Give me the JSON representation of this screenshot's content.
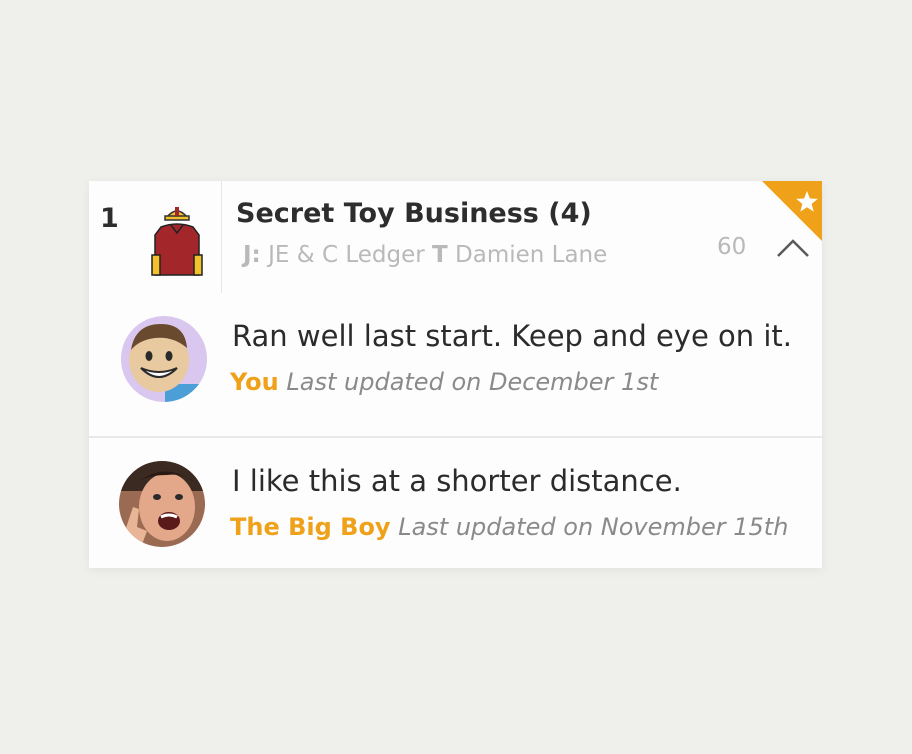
{
  "runner": {
    "number": "1",
    "name": "Secret Toy Business (4)",
    "jockey_prefix": "J:",
    "jockey": "JE & C Ledger",
    "trainer_prefix": "T",
    "trainer": "Damien Lane",
    "rating": "60",
    "collapse_icon": "chevron-up-icon",
    "favourite_icon": "star-icon"
  },
  "comments": [
    {
      "text": "Ran well last start. Keep and eye on it.",
      "author": "You",
      "updated": "Last updated on December 1st"
    },
    {
      "text": "I like this at a shorter distance.",
      "author": "The Big Boy",
      "updated": "Last updated on November 15th"
    }
  ],
  "colors": {
    "accent": "#f0a11a",
    "silks_body": "#a3262a",
    "silks_cap": "#f2c12e",
    "muted_text": "#b9b9b9"
  }
}
